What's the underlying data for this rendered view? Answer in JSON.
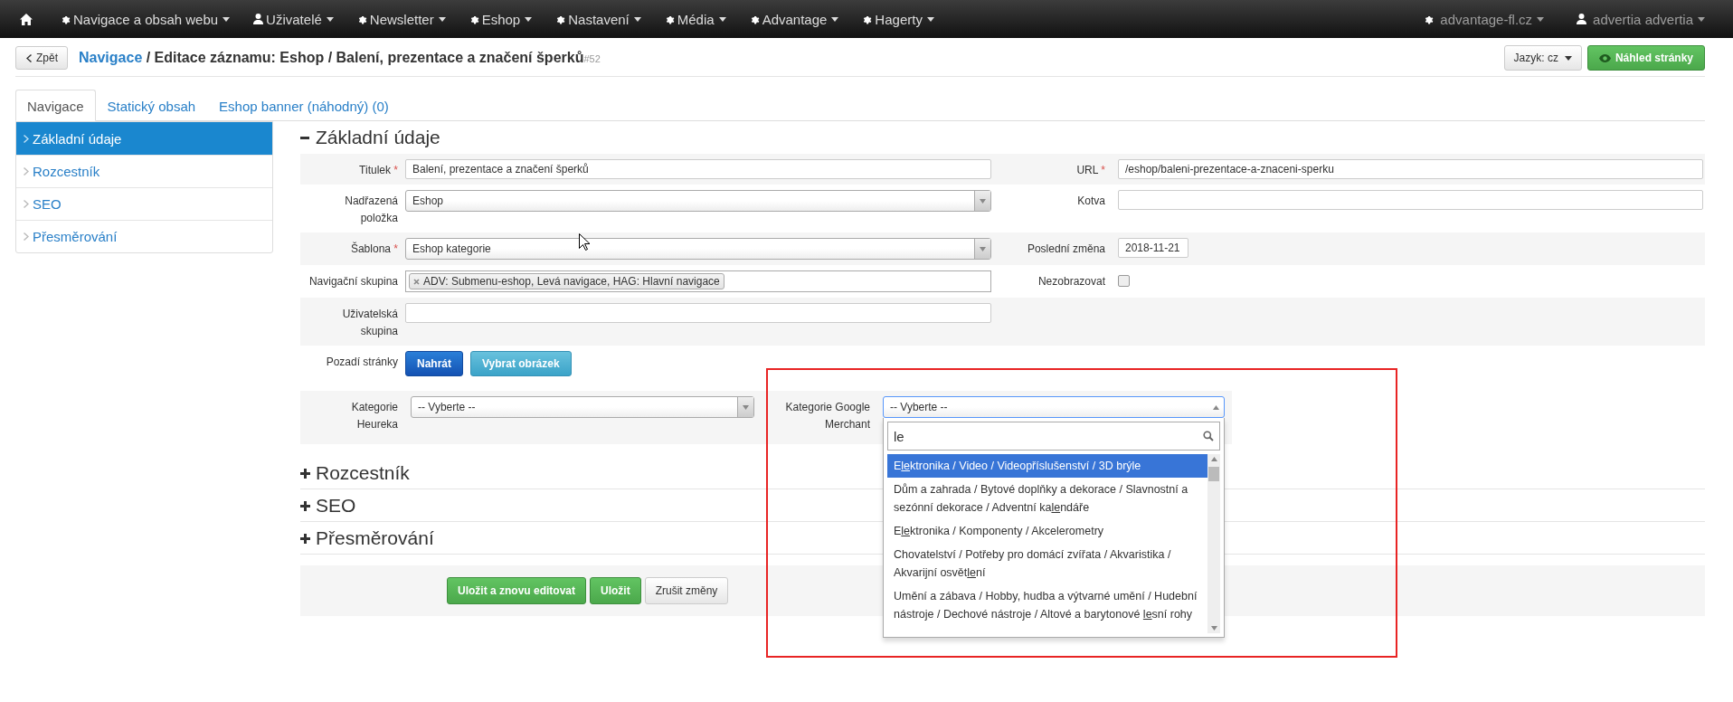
{
  "navbar": {
    "menus": [
      {
        "label": "Navigace a obsah webu",
        "kind": "gear"
      },
      {
        "label": "Uživatelé",
        "kind": "user"
      },
      {
        "label": "Newsletter",
        "kind": "gear"
      },
      {
        "label": "Eshop",
        "kind": "gear"
      },
      {
        "label": "Nastavení",
        "kind": "gear"
      },
      {
        "label": "Média",
        "kind": "gear"
      },
      {
        "label": "Advantage",
        "kind": "gear"
      },
      {
        "label": "Hagerty",
        "kind": "gear"
      }
    ],
    "right": [
      {
        "label": "advantage-fl.cz",
        "kind": "gear"
      },
      {
        "label": "advertia advertia",
        "kind": "user"
      }
    ]
  },
  "header": {
    "back": "Zpět",
    "breadcrumb_link": "Navigace",
    "title": " / Editace záznamu: Eshop / Balení, prezentace a značení šperků",
    "record_id": "#52",
    "language": "Jazyk: cz",
    "preview": "Náhled stránky"
  },
  "tabs": [
    {
      "label": "Navigace",
      "selected": true
    },
    {
      "label": "Statický obsah",
      "selected": false
    },
    {
      "label": "Eshop banner (náhodný) (0)",
      "selected": false
    }
  ],
  "sidebar": {
    "items": [
      {
        "label": "Základní údaje",
        "selected": true
      },
      {
        "label": "Rozcestník",
        "selected": false
      },
      {
        "label": "SEO",
        "selected": false
      },
      {
        "label": "Přesměrování",
        "selected": false
      }
    ]
  },
  "sections": [
    {
      "title": "Základní údaje",
      "expanded": true
    },
    {
      "title": "Rozcestník",
      "expanded": false
    },
    {
      "title": "SEO",
      "expanded": false
    },
    {
      "title": "Přesměrování",
      "expanded": false
    }
  ],
  "form": {
    "rows": [
      {
        "left": {
          "label": [
            "Titulek"
          ],
          "mark": "*",
          "kind": "text",
          "value": "Balení, prezentace a značení šperků"
        },
        "right": {
          "label": [
            "URL"
          ],
          "mark": "*",
          "kind": "text",
          "value": "/eshop/baleni-prezentace-a-znaceni-sperku"
        }
      },
      {
        "left": {
          "label": [
            "Nadřazená",
            "položka"
          ],
          "kind": "select",
          "value": "Eshop"
        },
        "right": {
          "label": [
            "Kotva"
          ],
          "kind": "text"
        }
      },
      {
        "left": {
          "label": [
            "Šablona"
          ],
          "mark": "*",
          "kind": "select",
          "value": "Eshop kategorie"
        },
        "right": {
          "label": [
            "Poslední změna"
          ],
          "kind": "date",
          "value": "2018-11-21"
        }
      },
      {
        "left": {
          "label": [
            "Navigační skupina"
          ],
          "kind": "tags",
          "tags": [
            "ADV: Submenu-eshop, Levá navigace, HAG: Hlavní navigace"
          ]
        },
        "right": {
          "label": [
            "Nezobrazovat"
          ],
          "kind": "checkbox",
          "checked": false
        }
      },
      {
        "left": {
          "label": [
            "Uživatelská",
            "skupina"
          ],
          "kind": "text"
        }
      },
      {
        "left": {
          "label": [
            "Pozadí stránky"
          ],
          "kind": "buttons",
          "buttons": [
            {
              "label": "Nahrát",
              "kind": "primary"
            },
            {
              "label": "Vybrat obrázek",
              "kind": "info"
            }
          ]
        }
      }
    ],
    "categories": [
      {
        "label": [
          "Kategorie",
          "Heureka"
        ],
        "value": "-- Vyberte --",
        "open": false
      },
      {
        "label": [
          "Kategorie Google",
          "Merchant"
        ],
        "value": "-- Vyberte --",
        "open": true,
        "search": "le",
        "options": [
          {
            "parts": [
              "E",
              "le",
              "ktronika / Video / Videopříslušenství / 3D brýle"
            ],
            "selected": true
          },
          {
            "parts": [
              "Dům a zahrada / Bytové doplňky a dekorace / Slavnostní a sezónní dekorace / Adventní ka",
              "le",
              "ndáře"
            ],
            "selected": false
          },
          {
            "parts": [
              "E",
              "le",
              "ktronika / Komponenty / Akcelerometry"
            ],
            "selected": false
          },
          {
            "parts": [
              "Chovatelství / Potřeby pro domácí zvířata / Akvaristika / Akvarijní osvět",
              "le",
              "ní"
            ],
            "selected": false
          },
          {
            "parts": [
              "Umění a zábava / Hobby, hudba a výtvarné umění / Hudební nástroje / Dechové nástroje / Altové a barytonové ",
              "le",
              "sní rohy"
            ],
            "selected": false
          }
        ]
      }
    ]
  },
  "footer": {
    "buttons": [
      {
        "label": "Uložit a znovu editovat",
        "kind": "success"
      },
      {
        "label": "Uložit",
        "kind": "success"
      },
      {
        "label": "Zrušit změny",
        "kind": "default"
      }
    ]
  }
}
